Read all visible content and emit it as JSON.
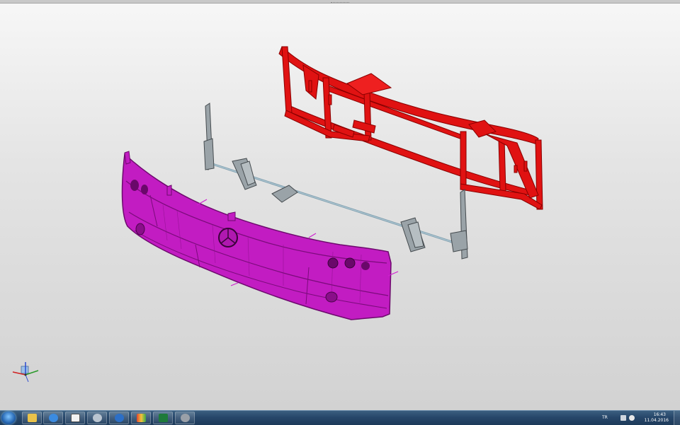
{
  "viewport": {
    "model_parts": [
      "bumper",
      "bracket-assembly",
      "frame"
    ],
    "colors": {
      "bumper": "#c21cc2",
      "bumper_edge": "#7b0b7b",
      "frame": "#e01212",
      "frame_edge": "#8a0000",
      "bracket": "#9aa3a8",
      "bracket_edge": "#454b4f",
      "rod": "#8fb0bf"
    }
  },
  "axis_triad": {
    "icon": "axis-triad-icon",
    "colors": {
      "x": "#d02020",
      "y": "#2a9a2a",
      "z": "#2a4ad0"
    }
  },
  "taskbar": {
    "start_icon": "windows-start-icon",
    "apps": [
      {
        "name": "file-explorer-icon",
        "color": "#e9c24a"
      },
      {
        "name": "internet-explorer-icon",
        "color": "#3b8be0"
      },
      {
        "name": "window-app-icon",
        "color": "#f2f2f2"
      },
      {
        "name": "gear-app-icon",
        "color": "#b9c4d0"
      },
      {
        "name": "globe-app-icon",
        "color": "#2c6fc6"
      },
      {
        "name": "colored-app-icon",
        "color": "#e0452f"
      },
      {
        "name": "excel-icon",
        "color": "#1e7a3a"
      },
      {
        "name": "cad-app-icon",
        "color": "#9aa0a8"
      }
    ],
    "tray": {
      "language": "TR",
      "time": "16:43",
      "date": "11.04.2016"
    }
  }
}
